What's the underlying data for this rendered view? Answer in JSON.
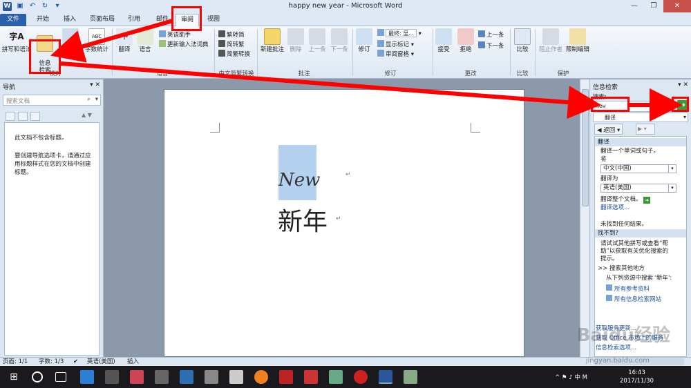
{
  "window": {
    "title": "happy new year - Microsoft Word"
  },
  "tabs": [
    "文件",
    "开始",
    "插入",
    "页面布局",
    "引用",
    "邮件",
    "审阅",
    "视图"
  ],
  "ribbon": {
    "proofing": {
      "spell": "拼写和语法",
      "research": "信息\n检索",
      "thesaurus": "同义词库",
      "wordcount": "字数统计",
      "label": "校对"
    },
    "language": {
      "translate": "翻译",
      "lang": "语言",
      "english_assist": "英语助手",
      "update_ime": "更新输入法词典",
      "label": "语言"
    },
    "chinese_conv": {
      "t2s": "繁转简",
      "s2t": "简转繁",
      "conv": "简繁转换",
      "label": "中文简繁转换"
    },
    "comments": {
      "new": "新建批注",
      "delete": "删除",
      "prev": "上一条",
      "next": "下一条",
      "label": "批注"
    },
    "tracking": {
      "track": "修订",
      "final": "最终: 显...",
      "show_markup": "显示标记",
      "review_pane": "审阅窗格",
      "label": "修订"
    },
    "changes": {
      "accept": "接受",
      "reject": "拒绝",
      "prev": "上一条",
      "next": "下一条",
      "label": "更改"
    },
    "compare": {
      "compare": "比较",
      "label": "比较"
    },
    "protect": {
      "block_authors": "阻止作者",
      "restrict": "限制编辑",
      "label": "保护"
    }
  },
  "nav": {
    "title": "导航",
    "search_placeholder": "搜索文档",
    "msg1": "此文档不包含标题。",
    "msg2": "要创建导航选项卡，请通过应用标题样式在您的文档中创建标题。"
  },
  "document": {
    "line1": "New",
    "line2": "新年",
    "para_mark": "↵"
  },
  "research": {
    "title": "信息检索",
    "search_label": "搜索:",
    "search_value": "New",
    "source": "翻译",
    "back": "返回",
    "sec_translate": "翻译",
    "translate_phrase": "翻译一个单词或句子。",
    "from_label": "将",
    "from_value": "中文(中国)",
    "to_label": "翻译为",
    "to_value": "英语(美国)",
    "translate_doc": "翻译整个文档。",
    "options": "翻译选项...",
    "no_results": "未找到任何结果。",
    "sec_not_found": "找不到?",
    "help_text_1": "请试试其他拼写或查看“帮",
    "help_text_2": "助”以获取有关优化搜索的",
    "help_text_3": "提示。",
    "search_elsewhere": ">> 搜索其他地方",
    "search_from": "从下列资源中搜索 '新年':",
    "all_refs": "所有参考资料",
    "all_sites": "所有信息检索网站",
    "get_updates": "获取服务更新...",
    "marketplace": "获取 Office 市场上的服务",
    "options_link": "信息检索选项..."
  },
  "status": {
    "page": "页面: 1/1",
    "words": "字数: 1/3",
    "lang": "英语(美国)",
    "mode": "插入"
  },
  "taskbar": {
    "time": "16:43",
    "date": "2017/11/30",
    "ime": "中"
  },
  "watermark": {
    "text": "Baidu经验",
    "sub": "jingyan.baidu.com"
  },
  "colors": {
    "accent": "#2b579a",
    "annotation": "#ff0000"
  }
}
